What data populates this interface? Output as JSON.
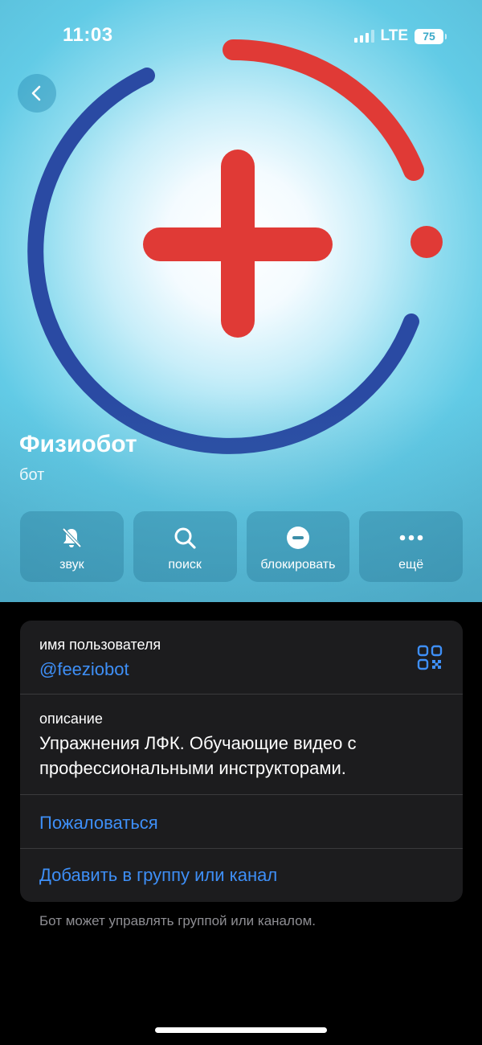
{
  "status_bar": {
    "time": "11:03",
    "network": "LTE",
    "battery": "75"
  },
  "profile": {
    "name": "Физиобот",
    "subtitle": "бот"
  },
  "actions": [
    {
      "label": "звук",
      "icon": "bell-slash-icon"
    },
    {
      "label": "поиск",
      "icon": "search-icon"
    },
    {
      "label": "блокировать",
      "icon": "block-icon"
    },
    {
      "label": "ещё",
      "icon": "more-icon"
    }
  ],
  "info": {
    "username_label": "имя пользователя",
    "username": "@feeziobot",
    "description_label": "описание",
    "description": "Упражнения ЛФК. Обучающие видео с профессиональными инструкторами.",
    "report": "Пожаловаться",
    "add_to_group": "Добавить в группу или канал"
  },
  "footer_note": "Бот может управлять группой или каналом.",
  "colors": {
    "link": "#3e8ff7",
    "logo_red": "#e03a36",
    "logo_blue": "#2a4aa3",
    "card": "#1c1c1e"
  }
}
